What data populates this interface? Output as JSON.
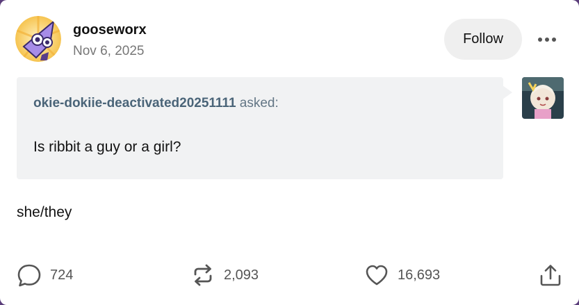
{
  "post": {
    "blog_name": "gooseworx",
    "date": "Nov 6, 2025",
    "follow_label": "Follow",
    "ask": {
      "asker": "okie-dokiie-deactivated20251111",
      "asked_label": "asked:",
      "question": "Is ribbit a guy or a girl?"
    },
    "answer": "she/they"
  },
  "footer": {
    "replies_count": "724",
    "reblogs_count": "2,093",
    "likes_count": "16,693"
  },
  "colors": {
    "card_background": "#ffffff",
    "ask_background": "#f1f2f3",
    "page_background": "#5a3d7a",
    "follow_button": "#efefef"
  },
  "icons": [
    "comment-icon",
    "reblog-icon",
    "heart-icon",
    "share-icon",
    "more-icon"
  ]
}
